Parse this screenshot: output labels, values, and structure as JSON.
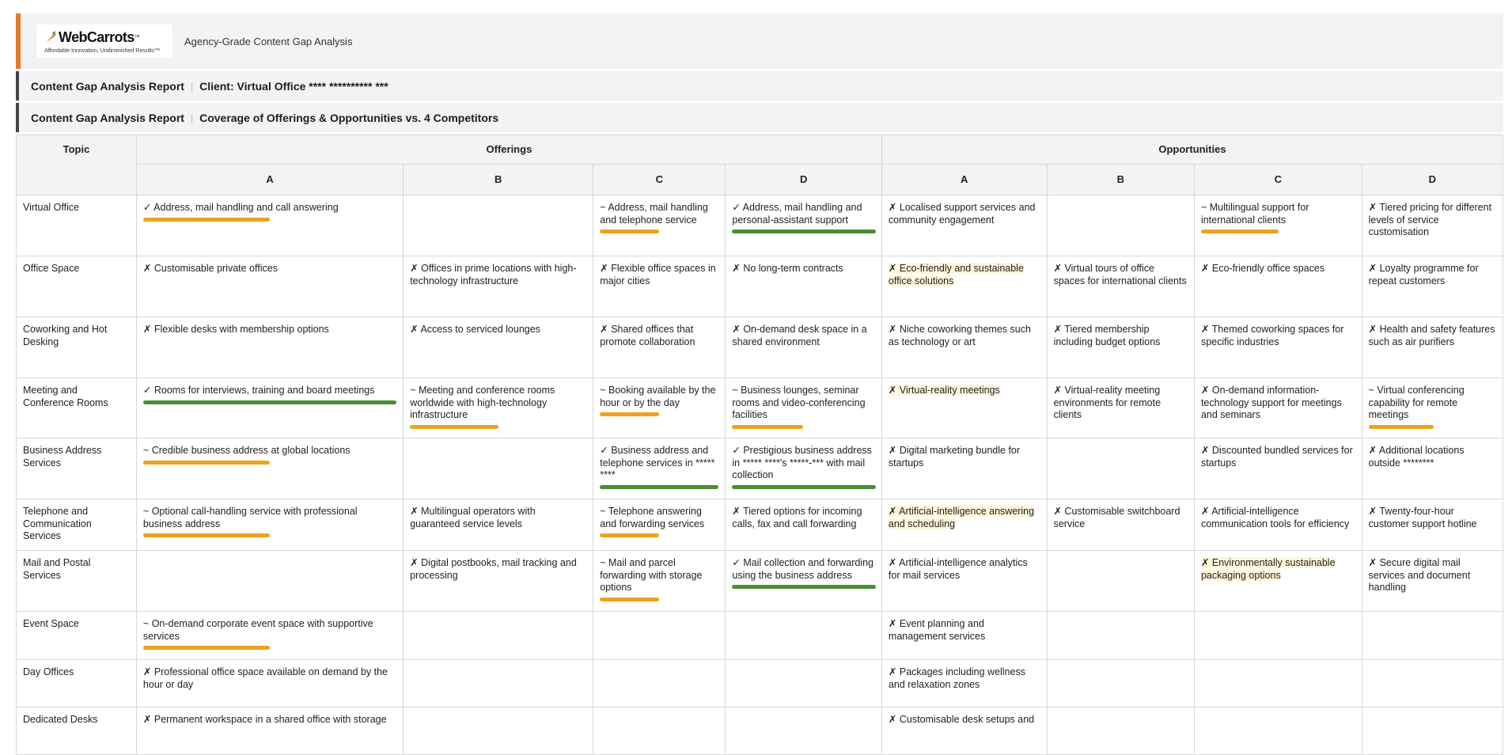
{
  "brand": {
    "name": "WebCarrots",
    "tm": "™",
    "tagline": "Affordable Innovation, Undiminished Results™",
    "subtitle": "Agency-Grade Content Gap Analysis"
  },
  "report1": {
    "title": "Content Gap Analysis Report",
    "client": "Client: Virtual Office **** ********** ***"
  },
  "report2": {
    "title": "Content Gap Analysis Report",
    "subtitle": "Coverage of Offerings & Opportunities vs. 4 Competitors"
  },
  "table": {
    "topic_header": "Topic",
    "offerings_header": "Offerings",
    "opportunities_header": "Opportunities",
    "sub_headers": [
      "A",
      "B",
      "C",
      "D"
    ],
    "colors": {
      "bar_orange": "#eba21c",
      "bar_green": "#4a8d33",
      "highlight": "#fff5d9"
    },
    "rows": [
      {
        "topic": "Virtual Office",
        "off": [
          "✓ Address, mail handling and call answering",
          "",
          "~ Address, mail handling and telephone service",
          "✓ Address, mail handling and personal-assistant support"
        ],
        "opp": [
          "✗ Localised support services and community engagement",
          "",
          "~ Multilingual support for international clients",
          "✗ Tiered pricing for different levels of service customisation"
        ]
      },
      {
        "topic": "Office Space",
        "off": [
          "✗ Customisable private offices",
          "✗ Offices in prime locations with high-technology infrastructure",
          "✗ Flexible office spaces in major cities",
          "✗ No long-term contracts"
        ],
        "opp": [
          "✗ Eco-friendly and sustainable office solutions",
          "✗ Virtual tours of office spaces for international clients",
          "✗ Eco-friendly office spaces",
          "✗ Loyalty programme for repeat customers"
        ]
      },
      {
        "topic": "Coworking and Hot Desking",
        "off": [
          "✗ Flexible desks with membership options",
          "✗ Access to serviced lounges",
          "✗ Shared offices that promote collaboration",
          "✗ On-demand desk space in a shared environment"
        ],
        "opp": [
          "✗ Niche coworking themes such as technology or art",
          "✗ Tiered membership including budget options",
          "✗ Themed coworking spaces for specific industries",
          "✗ Health and safety features such as air purifiers"
        ]
      },
      {
        "topic": "Meeting and Conference Rooms",
        "off": [
          "✓ Rooms for interviews, training and board meetings",
          "~ Meeting and conference rooms worldwide with high-technology infrastructure",
          "~ Booking available by the hour or by the day",
          "~ Business lounges, seminar rooms and video-conferencing facilities"
        ],
        "opp": [
          "✗ Virtual-reality meetings",
          "✗ Virtual-reality meeting environments for remote clients",
          "✗ On-demand information-technology support for meetings and seminars",
          "~ Virtual conferencing capability for remote meetings"
        ]
      },
      {
        "topic": "Business Address Services",
        "off": [
          "~ Credible business address at global locations",
          "",
          "✓ Business address and telephone services in ***** ****",
          "✓ Prestigious business address in ***** ****'s *****-*** with mail collection"
        ],
        "opp": [
          "✗ Digital marketing bundle for startups",
          "",
          "✗ Discounted bundled services for startups",
          "✗ Additional locations outside ********"
        ]
      },
      {
        "topic": "Telephone and Communication Services",
        "off": [
          "~ Optional call-handling service with professional business address",
          "✗ Multilingual operators with guaranteed service levels",
          "~ Telephone answering and forwarding services",
          "✗ Tiered options for incoming calls, fax and call forwarding"
        ],
        "opp": [
          "✗ Artificial-intelligence answering and scheduling",
          "✗ Customisable switchboard service",
          "✗ Artificial-intelligence communication tools for efficiency",
          "✗ Twenty-four-hour customer support hotline"
        ]
      },
      {
        "topic": "Mail and Postal Services",
        "off": [
          "",
          "✗ Digital postbooks, mail tracking and processing",
          "~ Mail and parcel forwarding with storage options",
          "✓ Mail collection and forwarding using the business address"
        ],
        "opp": [
          "✗ Artificial-intelligence analytics for mail services",
          "",
          "✗ Environmentally sustainable packaging options",
          "✗ Secure digital mail services and document handling"
        ]
      },
      {
        "topic": "Event Space",
        "off": [
          "~ On-demand corporate event space with supportive services",
          "",
          "",
          ""
        ],
        "opp": [
          "✗ Event planning and management services",
          "",
          "",
          ""
        ]
      },
      {
        "topic": "Day Offices",
        "off": [
          "✗ Professional office space available on demand by the hour or day",
          "",
          "",
          ""
        ],
        "opp": [
          "✗ Packages including wellness and relaxation zones",
          "",
          "",
          ""
        ]
      },
      {
        "topic": "Dedicated Desks",
        "off": [
          "✗ Permanent workspace in a shared office with storage",
          "",
          "",
          ""
        ],
        "opp": [
          "✗ Customisable desk setups and",
          "",
          "",
          ""
        ]
      }
    ]
  }
}
